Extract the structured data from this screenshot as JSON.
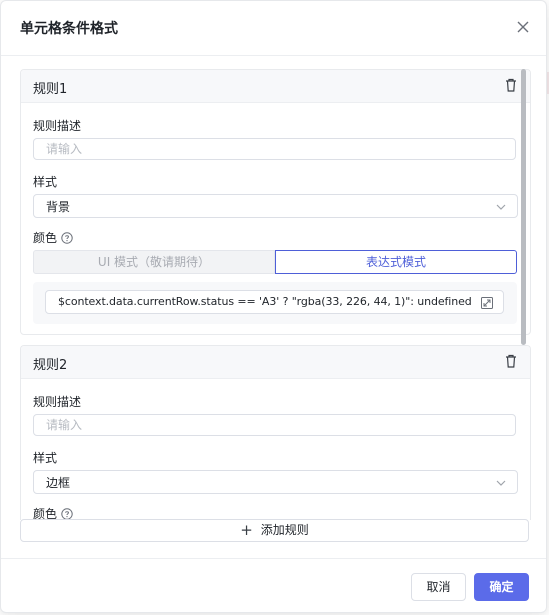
{
  "dialog": {
    "title": "单元格条件格式",
    "close_icon": "close-icon"
  },
  "rules": [
    {
      "title": "规则1",
      "description_label": "规则描述",
      "description_placeholder": "请输入",
      "style_label": "样式",
      "style_value": "背景",
      "color_label": "颜色",
      "mode_ui_label": "UI 模式（敬请期待）",
      "mode_expr_label": "表达式模式",
      "expression": "$context.data.currentRow.status == 'A3' ? \"rgba(33, 226, 44, 1)\": undefined"
    },
    {
      "title": "规则2",
      "description_label": "规则描述",
      "description_placeholder": "请输入",
      "style_label": "样式",
      "style_value": "边框",
      "color_label": "颜色"
    }
  ],
  "add_rule_label": "添加规则",
  "footer": {
    "cancel_label": "取消",
    "ok_label": "确定"
  },
  "colors": {
    "primary": "#5b6be9",
    "border": "#dcdfe6",
    "header_bg": "#f7f8fa"
  }
}
